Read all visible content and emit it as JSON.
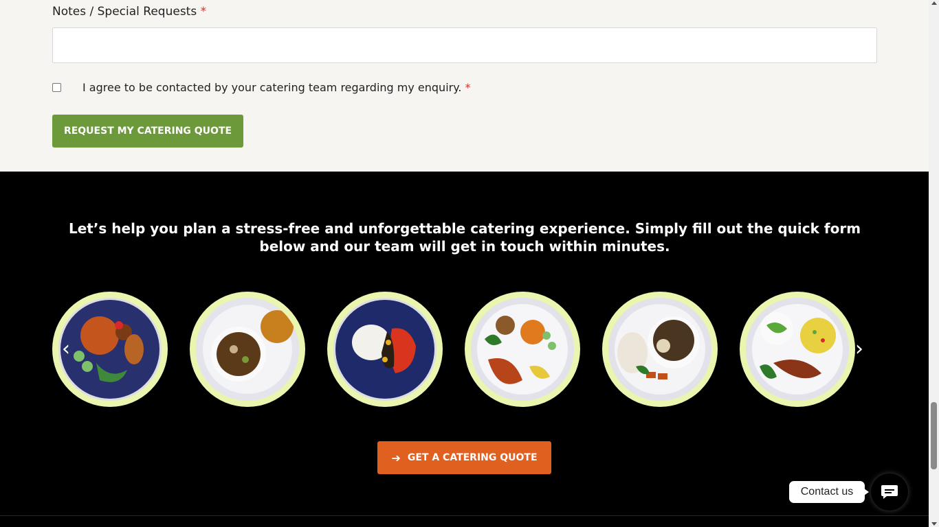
{
  "form": {
    "notes_label": "Notes / Special Requests",
    "required_mark": "*",
    "notes_value": "",
    "consent_text": "I agree to be contacted by your catering team regarding my enquiry.",
    "consent_checked": false,
    "submit_label": "REQUEST MY CATERING QUOTE"
  },
  "promo": {
    "tagline": "Let’s help you plan a stress-free and unforgettable catering experience. Simply fill out the quick form below and our team will get in touch within minutes.",
    "carousel": {
      "prev_icon": "chevron-left-icon",
      "next_icon": "chevron-right-icon",
      "items": [
        {
          "name": "dish-jollof-rice-chicken"
        },
        {
          "name": "dish-soup-bread"
        },
        {
          "name": "dish-fufu-stew"
        },
        {
          "name": "dish-jollof-chicken-salad"
        },
        {
          "name": "dish-rice-goat-stew"
        },
        {
          "name": "dish-fried-rice-salad-fish"
        }
      ]
    },
    "cta_label": "GET A CATERING QUOTE",
    "cta_icon": "arrow-right-icon"
  },
  "chat": {
    "label": "Contact us",
    "icon": "chat-bubble-icon"
  },
  "colors": {
    "form_bg": "#f7f5f1",
    "submit_green": "#6c9a3a",
    "cta_orange": "#e06020",
    "plate_ring": "#eaf5b0",
    "required_red": "#d1332b"
  }
}
